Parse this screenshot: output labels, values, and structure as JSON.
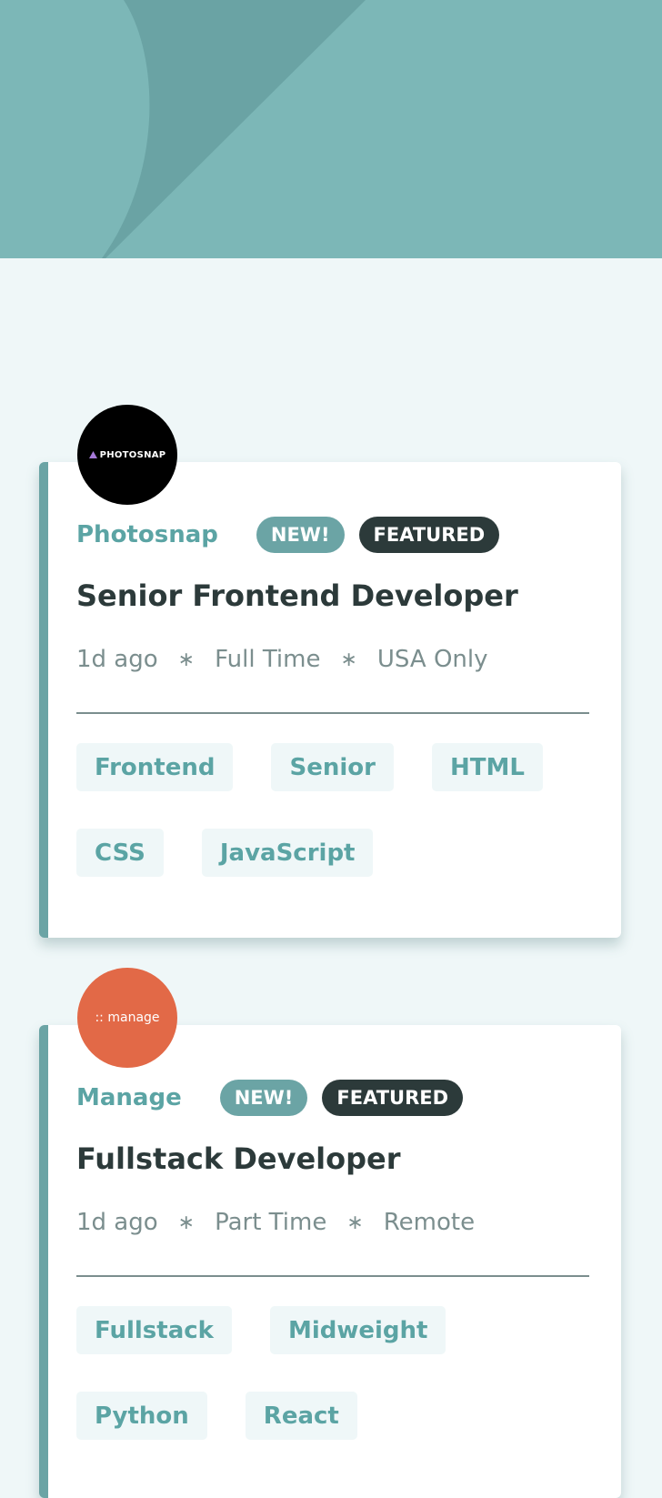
{
  "header": {
    "bg_color": "#7cb7b7",
    "pattern_color": "#6aa3a4"
  },
  "jobs": [
    {
      "company": "Photosnap",
      "logo_text": "PHOTOSNAP",
      "logo_color": "#000000",
      "badge_new": "NEW!",
      "badge_featured": "FEATURED",
      "position": "Senior Frontend Developer",
      "posted": "1d ago",
      "contract": "Full Time",
      "location": "USA Only",
      "tags": [
        "Frontend",
        "Senior",
        "HTML",
        "CSS",
        "JavaScript"
      ]
    },
    {
      "company": "Manage",
      "logo_text": ":: manage",
      "logo_color": "#e26947",
      "badge_new": "NEW!",
      "badge_featured": "FEATURED",
      "position": "Fullstack Developer",
      "posted": "1d ago",
      "contract": "Part Time",
      "location": "Remote",
      "tags": [
        "Fullstack",
        "Midweight",
        "Python",
        "React"
      ]
    }
  ],
  "separator_glyph": "∗",
  "colors": {
    "accent": "#5ba4a4",
    "dark": "#2c3a3a",
    "muted": "#7b8e8e",
    "background": "#eff7f8"
  }
}
